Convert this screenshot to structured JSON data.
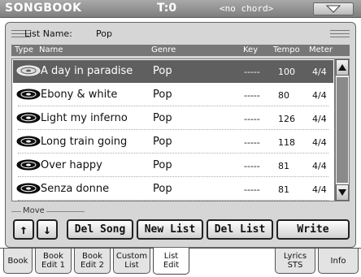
{
  "header": {
    "title": "SONGBOOK",
    "tempo": "T:0",
    "chord": "<no chord>"
  },
  "list_name": {
    "label": "List Name:",
    "value": "Pop"
  },
  "columns": [
    "Type",
    "Name",
    "Genre",
    "Key",
    "Tempo",
    "Meter"
  ],
  "rows": [
    {
      "name": "A day in paradise",
      "genre": "Pop",
      "key": "-----",
      "tempo": "100",
      "meter": "4/4"
    },
    {
      "name": "Ebony & white",
      "genre": "Pop",
      "key": "-----",
      "tempo": "80",
      "meter": "4/4"
    },
    {
      "name": "Light my inferno",
      "genre": "Pop",
      "key": "-----",
      "tempo": "126",
      "meter": "4/4"
    },
    {
      "name": "Long train going",
      "genre": "Pop",
      "key": "-----",
      "tempo": "118",
      "meter": "4/4"
    },
    {
      "name": "Over happy",
      "genre": "Pop",
      "key": "-----",
      "tempo": "81",
      "meter": "4/4"
    },
    {
      "name": "Senza donne",
      "genre": "Pop",
      "key": "-----",
      "tempo": "81",
      "meter": "4/4"
    }
  ],
  "selected_row": 0,
  "move_label": "Move",
  "buttons": {
    "up": "↑",
    "down": "↓",
    "del_song": "Del Song",
    "new_list": "New List",
    "del_list": "Del List",
    "write": "Write"
  },
  "tabs": [
    {
      "label": "Book"
    },
    {
      "label": "Book\nEdit 1"
    },
    {
      "label": "Book\nEdit 2"
    },
    {
      "label": "Custom\nList"
    },
    {
      "label": "List\nEdit"
    },
    {
      "label": "Lyrics\nSTS"
    },
    {
      "label": "Info"
    }
  ],
  "active_tab": 4,
  "icons": {
    "row_icon": "disc-icon",
    "menu": "dropdown-triangle-icon"
  },
  "colors": {
    "selection": "#5f5f5f",
    "panel": "#d6d6d6",
    "header": "#777777"
  }
}
